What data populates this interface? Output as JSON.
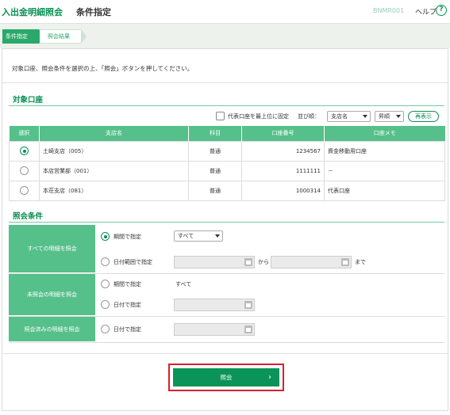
{
  "header": {
    "app_title": "入出金明細照会",
    "page_title": "条件指定",
    "screen_id": "BNMR001",
    "help_label": "ヘルプ",
    "help_icon_char": "?"
  },
  "steps": [
    {
      "label": "条件指定",
      "active": true
    },
    {
      "label": "照会結果",
      "active": false
    }
  ],
  "instruction": "対象口座、照会条件を選択の上、「照会」ボタンを押してください。",
  "accounts_section": {
    "title": "対象口座",
    "pin_option_label": "代表口座を最上位に固定",
    "sort_label": "並び順：",
    "sort_field_value": "支店名",
    "sort_order_value": "昇順",
    "redisplay_label": "再表示",
    "columns": [
      "選択",
      "支店名",
      "科目",
      "口座番号",
      "口座メモ"
    ],
    "rows": [
      {
        "selected": true,
        "branch": "土崎支店（005）",
        "subject": "普通",
        "number": "1234567",
        "memo": "資金移動用口座"
      },
      {
        "selected": false,
        "branch": "本店営業部（001）",
        "subject": "普通",
        "number": "1111111",
        "memo": "－"
      },
      {
        "selected": false,
        "branch": "本荘支店（081）",
        "subject": "普通",
        "number": "1000314",
        "memo": "代表口座"
      }
    ]
  },
  "conditions_section": {
    "title": "照会条件",
    "all_label": "すべての明細を照会",
    "period_label": "期間で指定",
    "period_value": "すべて",
    "date_range_label": "日付範囲で指定",
    "from_label": "から",
    "to_label": "まで",
    "unread_label": "未照会の明細を照会",
    "unread_period_label": "期間で指定",
    "unread_period_value": "すべて",
    "unread_date_label": "日付で指定",
    "read_label": "照会済みの明細を照会",
    "read_date_label": "日付で指定"
  },
  "submit": {
    "label": "照会",
    "chevron": "›"
  },
  "colors": {
    "brand_green": "#0a8f55",
    "header_green": "#56c08a",
    "highlight_red": "#d8202a"
  }
}
